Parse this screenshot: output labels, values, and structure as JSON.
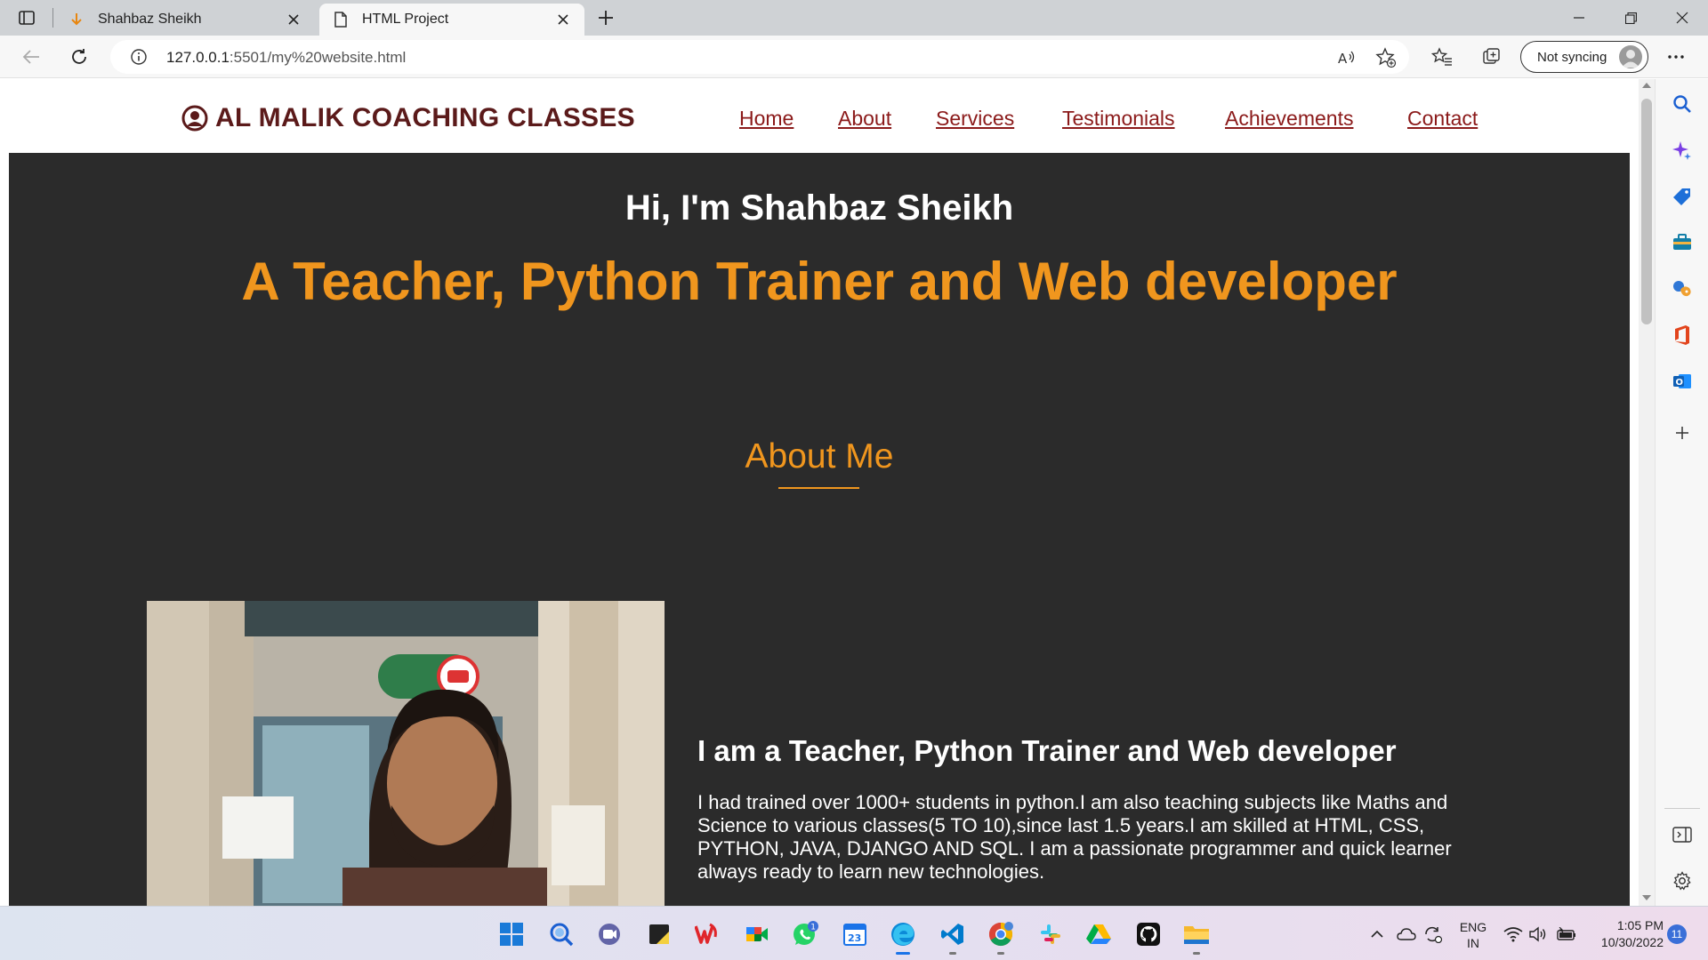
{
  "browser": {
    "tabs": [
      {
        "title": "Shahbaz Sheikh",
        "active": false
      },
      {
        "title": "HTML Project",
        "active": true
      }
    ],
    "url": {
      "host": "127.0.0.1",
      "path": ":5501/my%20website.html"
    },
    "sync_label": "Not syncing"
  },
  "site": {
    "brand": "AL MALIK COACHING CLASSES",
    "nav": [
      "Home",
      "About",
      "Services",
      "Testimonials",
      "Achievements",
      "Contact"
    ],
    "hero": {
      "greeting": "Hi, I'm Shahbaz Sheikh",
      "tagline": "A Teacher, Python Trainer and Web developer"
    },
    "about": {
      "title": "About Me",
      "heading": "I am a Teacher, Python Trainer and Web developer",
      "paragraph": "I had trained over 1000+ students in python.I am also teaching subjects like Maths and Science to various classes(5 TO 10),since last 1.5 years.I am skilled at HTML, CSS, PYTHON, JAVA, DJANGO AND SQL. I am a passionate programmer and quick learner always ready to learn new technologies."
    }
  },
  "sidepanel": [
    "search-icon",
    "copilot-icon",
    "shopping-icon",
    "tools-icon",
    "games-icon",
    "office-icon",
    "outlook-icon",
    "add-icon",
    "sidebar-toggle-icon",
    "settings-icon"
  ],
  "taskbar": {
    "apps": [
      "start-icon",
      "search-icon",
      "teams-icon",
      "sticky-notes-icon",
      "wps-icon",
      "meet-icon",
      "whatsapp-icon",
      "calendar-icon",
      "edge-icon",
      "vscode-icon",
      "chrome-icon",
      "slack-icon",
      "drive-icon",
      "github-icon",
      "file-explorer-icon"
    ],
    "whatsapp_badge": "1",
    "calendar_date": "23",
    "language": {
      "line1": "ENG",
      "line2": "IN"
    },
    "time": "1:05 PM",
    "date": "10/30/2022",
    "notifications": "11"
  },
  "colors": {
    "accent": "#f0961e",
    "brand": "#5b1a1a",
    "link": "#8b1a1a",
    "hero_bg": "#2b2b2b"
  }
}
